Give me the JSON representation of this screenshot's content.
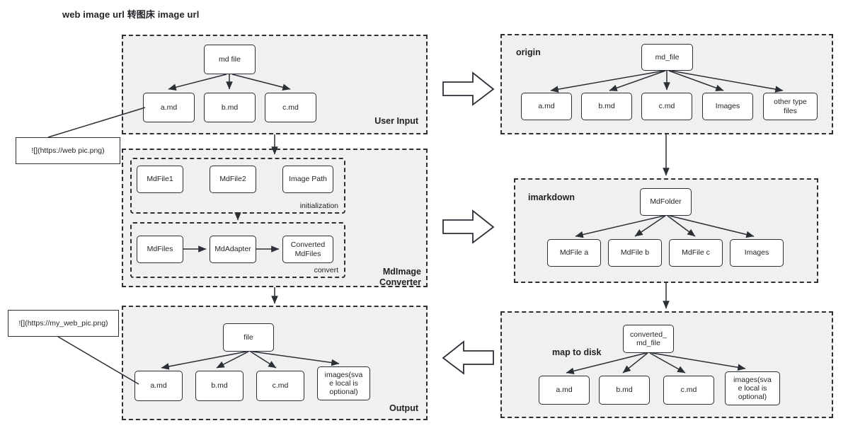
{
  "title": "web image url 转图床 image url",
  "left_column": {
    "user_input": {
      "label": "User Input",
      "root": "md file",
      "children": [
        "a.md",
        "b.md",
        "c.md"
      ]
    },
    "md_image_converter": {
      "label_line1": "MdImage",
      "label_line2": "Converter",
      "initialization": {
        "label": "initialization",
        "nodes": [
          "MdFile1",
          "MdFile2",
          "Image Path"
        ]
      },
      "convert": {
        "label": "convert",
        "nodes": [
          "MdFiles",
          "MdAdapter",
          "Converted\nMdFiles"
        ],
        "node_3_line1": "Converted",
        "node_3_line2": "MdFiles"
      }
    },
    "output": {
      "label": "Output",
      "root": "file",
      "children": [
        "a.md",
        "b.md",
        "c.md",
        "images(sva e local is optional)"
      ],
      "child_4_line1": "images(sva",
      "child_4_line2": "e local is",
      "child_4_line3": "optional)"
    },
    "annotations": {
      "web_pic": "![](https://web pic.png)",
      "my_web_pic": "![](https://my_web_pic.png)"
    }
  },
  "right_column": {
    "origin": {
      "label": "origin",
      "root": "md_file",
      "children": [
        "a.md",
        "b.md",
        "c.md",
        "Images",
        "other type files"
      ],
      "child_5_line1": "other type",
      "child_5_line2": "files"
    },
    "imarkdown": {
      "label": "imarkdown",
      "root": "MdFolder",
      "children": [
        "MdFile a",
        "MdFile b",
        "MdFile c",
        "Images"
      ]
    },
    "map_to_disk": {
      "label": "map to disk",
      "root_line1": "converted_",
      "root_line2": "md_file",
      "children": [
        "a.md",
        "b.md",
        "c.md",
        "images(sva e local is optional)"
      ],
      "child_4_line1": "images(sva",
      "child_4_line2": "e local is",
      "child_4_line3": "optional)"
    }
  },
  "connectors": {
    "arrow_right_top": "right-block-arrow",
    "arrow_right_middle": "right-block-arrow",
    "arrow_left_bottom": "left-block-arrow"
  },
  "colors": {
    "group_fill": "#f0f0f0",
    "stroke": "#2b2f36",
    "node_fill": "#ffffff",
    "text": "#1f2125"
  }
}
